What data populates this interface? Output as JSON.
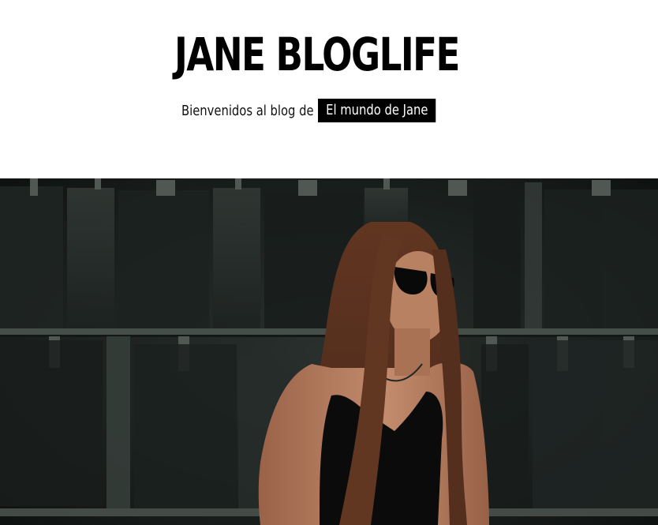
{
  "header": {
    "site_title": "JANE BLOGLIFE",
    "tagline_prefix": "Bienvenidos al blog de",
    "tagline_highlight": "El mundo de Jane"
  },
  "hero": {
    "image_subject": "woman-with-sunglasses-photo",
    "colors": {
      "background_dark": "#1e2422",
      "hair": "#5a3220",
      "skin": "#c78a68",
      "top": "#0c0c0c"
    }
  }
}
